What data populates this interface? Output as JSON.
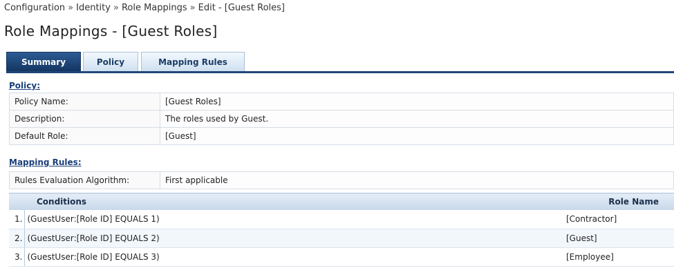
{
  "breadcrumb": {
    "items": [
      "Configuration",
      "Identity",
      "Role Mappings",
      "Edit - [Guest Roles]"
    ],
    "separator": "»"
  },
  "page_title": "Role Mappings - [Guest Roles]",
  "tabs": [
    {
      "label": "Summary",
      "active": true
    },
    {
      "label": "Policy",
      "active": false
    },
    {
      "label": "Mapping Rules",
      "active": false
    }
  ],
  "policy_section": {
    "heading": "Policy:",
    "rows": [
      {
        "label": "Policy Name:",
        "value": "[Guest Roles]"
      },
      {
        "label": "Description:",
        "value": "The roles used by Guest."
      },
      {
        "label": "Default Role:",
        "value": "[Guest]"
      }
    ]
  },
  "mapping_section": {
    "heading": "Mapping Rules:",
    "algorithm_label": "Rules Evaluation Algorithm:",
    "algorithm_value": "First applicable",
    "columns": {
      "conditions": "Conditions",
      "role_name": "Role Name"
    },
    "rules": [
      {
        "num": "1.",
        "condition": "(GuestUser:[Role ID] EQUALS 1)",
        "role": "[Contractor]"
      },
      {
        "num": "2.",
        "condition": "(GuestUser:[Role ID] EQUALS 2)",
        "role": "[Guest]"
      },
      {
        "num": "3.",
        "condition": "(GuestUser:[Role ID] EQUALS 3)",
        "role": "[Employee]"
      }
    ]
  },
  "colors": {
    "tab_active": "#1f4678",
    "link": "#1a3f7a",
    "row_alt": "#f2f7fc"
  }
}
